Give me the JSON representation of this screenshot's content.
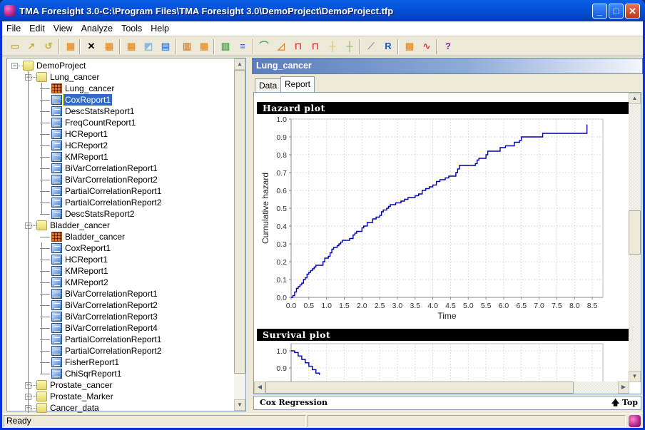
{
  "window": {
    "title": "TMA Foresight 3.0-C:\\Program Files\\TMA Foresight 3.0\\DemoProject\\DemoProject.tfp",
    "controls": {
      "minimize": "_",
      "maximize": "□",
      "close": "✕"
    }
  },
  "menu": [
    "File",
    "Edit",
    "View",
    "Analyze",
    "Tools",
    "Help"
  ],
  "toolbar": {
    "buttons": [
      {
        "name": "new-project-icon",
        "glyph": "▭"
      },
      {
        "name": "open-project-icon",
        "glyph": "↗"
      },
      {
        "name": "close-project-icon",
        "glyph": "↺"
      },
      {
        "name": "import-data-icon",
        "glyph": "▦"
      },
      {
        "name": "delete-icon",
        "glyph": "✕"
      },
      {
        "name": "new-table-icon",
        "glyph": "▦"
      },
      {
        "name": "export-table-icon",
        "glyph": "▦"
      },
      {
        "name": "export-chart-icon",
        "glyph": "◩"
      },
      {
        "name": "export-report-icon",
        "glyph": "▤"
      },
      {
        "name": "merge-data-icon",
        "glyph": "▥"
      },
      {
        "name": "sort-table-icon",
        "glyph": "▦"
      },
      {
        "name": "histogram-icon",
        "glyph": "▥"
      },
      {
        "name": "frequency-icon",
        "glyph": "≡"
      },
      {
        "name": "kaplan-meier-icon",
        "glyph": "⌒"
      },
      {
        "name": "cox-regression-icon",
        "glyph": "◿"
      },
      {
        "name": "cluster-icon",
        "glyph": "⊓"
      },
      {
        "name": "dendrogram-icon",
        "glyph": "⊓"
      },
      {
        "name": "scatter-icon",
        "glyph": "┼"
      },
      {
        "name": "correlation-icon",
        "glyph": "┼"
      },
      {
        "name": "regression-icon",
        "glyph": "⟋"
      },
      {
        "name": "r-value-icon",
        "glyph": "R"
      },
      {
        "name": "contingency-icon",
        "glyph": "▦"
      },
      {
        "name": "distribution-icon",
        "glyph": "∿"
      },
      {
        "name": "help-book-icon",
        "glyph": "?"
      }
    ]
  },
  "tree": {
    "nodes": [
      {
        "label": "DemoProject",
        "level": 0,
        "type": "folder",
        "expanded": true
      },
      {
        "label": "Lung_cancer",
        "level": 1,
        "type": "folder",
        "expanded": true
      },
      {
        "label": "Lung_cancer",
        "level": 2,
        "type": "table"
      },
      {
        "label": "CoxReport1",
        "level": 2,
        "type": "report",
        "selected": true
      },
      {
        "label": "DescStatsReport1",
        "level": 2,
        "type": "report"
      },
      {
        "label": "FreqCountReport1",
        "level": 2,
        "type": "report"
      },
      {
        "label": "HCReport1",
        "level": 2,
        "type": "report"
      },
      {
        "label": "HCReport2",
        "level": 2,
        "type": "report"
      },
      {
        "label": "KMReport1",
        "level": 2,
        "type": "report"
      },
      {
        "label": "BiVarCorrelationReport1",
        "level": 2,
        "type": "report"
      },
      {
        "label": "BiVarCorrelationReport2",
        "level": 2,
        "type": "report"
      },
      {
        "label": "PartialCorrelationReport1",
        "level": 2,
        "type": "report"
      },
      {
        "label": "PartialCorrelationReport2",
        "level": 2,
        "type": "report"
      },
      {
        "label": "DescStatsReport2",
        "level": 2,
        "type": "report"
      },
      {
        "label": "Bladder_cancer",
        "level": 1,
        "type": "folder",
        "expanded": true
      },
      {
        "label": "Bladder_cancer",
        "level": 2,
        "type": "table"
      },
      {
        "label": "CoxReport1",
        "level": 2,
        "type": "report"
      },
      {
        "label": "HCReport1",
        "level": 2,
        "type": "report"
      },
      {
        "label": "KMReport1",
        "level": 2,
        "type": "report"
      },
      {
        "label": "KMReport2",
        "level": 2,
        "type": "report"
      },
      {
        "label": "BiVarCorrelationReport1",
        "level": 2,
        "type": "report"
      },
      {
        "label": "BiVarCorrelationReport2",
        "level": 2,
        "type": "report"
      },
      {
        "label": "BiVarCorrelationReport3",
        "level": 2,
        "type": "report"
      },
      {
        "label": "BiVarCorrelationReport4",
        "level": 2,
        "type": "report"
      },
      {
        "label": "PartialCorrelationReport1",
        "level": 2,
        "type": "report"
      },
      {
        "label": "PartialCorrelationReport2",
        "level": 2,
        "type": "report"
      },
      {
        "label": "FisherReport1",
        "level": 2,
        "type": "report"
      },
      {
        "label": "ChiSqrReport1",
        "level": 2,
        "type": "report"
      },
      {
        "label": "Prostate_cancer",
        "level": 1,
        "type": "folder",
        "expanded": false
      },
      {
        "label": "Prostate_Marker",
        "level": 1,
        "type": "folder",
        "expanded": false
      },
      {
        "label": "Cancer_data",
        "level": 1,
        "type": "folder",
        "expanded": false
      }
    ]
  },
  "panel": {
    "title": "Lung_cancer",
    "tabs": [
      {
        "label": "Data",
        "active": false
      },
      {
        "label": "Report",
        "active": true
      }
    ],
    "sections": [
      "Hazard plot",
      "Survival plot"
    ],
    "footer_left": "Cox Regression",
    "footer_right": "Top"
  },
  "status": {
    "text": "Ready"
  },
  "chart_data": [
    {
      "type": "line",
      "step": true,
      "title": "Hazard plot",
      "xlabel": "Time",
      "ylabel": "Cumulative hazard",
      "xlim": [
        0,
        8.8
      ],
      "ylim": [
        0,
        1.0
      ],
      "xticks": [
        "0.0",
        "0.5",
        "1.0",
        "1.5",
        "2.0",
        "2.5",
        "3.0",
        "3.5",
        "4.0",
        "4.5",
        "5.0",
        "5.5",
        "6.0",
        "6.5",
        "7.0",
        "7.5",
        "8.0",
        "8.5"
      ],
      "yticks": [
        "0.0",
        "0.1",
        "0.2",
        "0.3",
        "0.4",
        "0.5",
        "0.6",
        "0.7",
        "0.8",
        "0.9",
        "1.0"
      ],
      "grid": true,
      "series": [
        {
          "name": "Cumulative hazard",
          "color": "#0000aa",
          "x": [
            0.0,
            0.05,
            0.1,
            0.15,
            0.2,
            0.25,
            0.3,
            0.35,
            0.4,
            0.45,
            0.5,
            0.55,
            0.6,
            0.65,
            0.7,
            0.85,
            0.9,
            0.95,
            1.05,
            1.1,
            1.15,
            1.2,
            1.3,
            1.35,
            1.4,
            1.45,
            1.65,
            1.75,
            1.8,
            1.85,
            2.0,
            2.05,
            2.15,
            2.3,
            2.4,
            2.5,
            2.55,
            2.6,
            2.7,
            2.75,
            2.8,
            2.95,
            3.1,
            3.2,
            3.3,
            3.5,
            3.6,
            3.7,
            3.8,
            3.9,
            4.0,
            4.1,
            4.2,
            4.35,
            4.45,
            4.65,
            4.7,
            4.75,
            5.2,
            5.25,
            5.3,
            5.5,
            5.55,
            5.9,
            6.05,
            6.3,
            6.45,
            6.5,
            7.1,
            8.3,
            8.35
          ],
          "y": [
            0.0,
            0.01,
            0.03,
            0.05,
            0.06,
            0.07,
            0.08,
            0.1,
            0.11,
            0.13,
            0.14,
            0.15,
            0.16,
            0.17,
            0.18,
            0.18,
            0.2,
            0.22,
            0.23,
            0.25,
            0.27,
            0.28,
            0.29,
            0.3,
            0.31,
            0.32,
            0.33,
            0.35,
            0.36,
            0.37,
            0.39,
            0.4,
            0.42,
            0.44,
            0.45,
            0.46,
            0.48,
            0.49,
            0.5,
            0.51,
            0.52,
            0.53,
            0.54,
            0.55,
            0.56,
            0.57,
            0.58,
            0.6,
            0.61,
            0.62,
            0.63,
            0.65,
            0.66,
            0.67,
            0.68,
            0.7,
            0.72,
            0.74,
            0.75,
            0.77,
            0.78,
            0.8,
            0.82,
            0.84,
            0.85,
            0.87,
            0.88,
            0.9,
            0.92,
            0.92,
            0.97
          ]
        }
      ]
    },
    {
      "type": "line",
      "step": true,
      "title": "Survival plot",
      "yticks": [
        "0.9",
        "1.0"
      ],
      "grid": true,
      "partial": true,
      "series": [
        {
          "name": "Survival",
          "color": "#0000aa",
          "x": [
            0.0,
            0.1,
            0.2,
            0.3,
            0.4,
            0.5,
            0.6,
            0.7,
            0.8
          ],
          "y": [
            1.0,
            0.99,
            0.97,
            0.95,
            0.93,
            0.91,
            0.89,
            0.87,
            0.86
          ]
        }
      ]
    }
  ]
}
